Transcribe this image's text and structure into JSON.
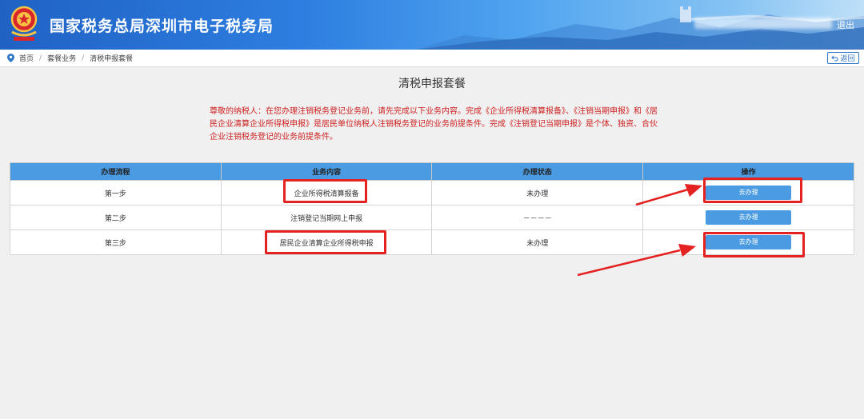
{
  "header": {
    "site_title": "国家税务总局深圳市电子税务局",
    "logout_label": "退出"
  },
  "breadcrumb": {
    "items": [
      "首页",
      "套餐业务",
      "清税申报套餐"
    ],
    "back_label": "返回"
  },
  "page": {
    "title": "清税申报套餐",
    "notice": "尊敬的纳税人：在您办理注销税务登记业务前，请先完成以下业务内容。完成《企业所得税清算报备》、《注销当期申报》和《居民企业清算企业所得税申报》是居民单位纳税人注销税务登记的业务前提条件。完成《注销登记当期申报》是个体、独资、合伙企业注销税务登记的业务前提条件。"
  },
  "table": {
    "headers": [
      "办理流程",
      "业务内容",
      "办理状态",
      "操作"
    ],
    "rows": [
      {
        "step": "第一步",
        "content": "企业所得税清算报备",
        "status": "未办理",
        "action": "去办理"
      },
      {
        "step": "第二步",
        "content": "注销登记当期网上申报",
        "status": "－－－－",
        "action": "去办理"
      },
      {
        "step": "第三步",
        "content": "居民企业清算企业所得税申报",
        "status": "未办理",
        "action": "去办理"
      }
    ]
  },
  "colors": {
    "header_blue": "#1f62c4",
    "table_header": "#4a9be2",
    "button_blue": "#4a9be2",
    "notice_red": "#cc1f1f",
    "highlight_red": "#e52222"
  }
}
